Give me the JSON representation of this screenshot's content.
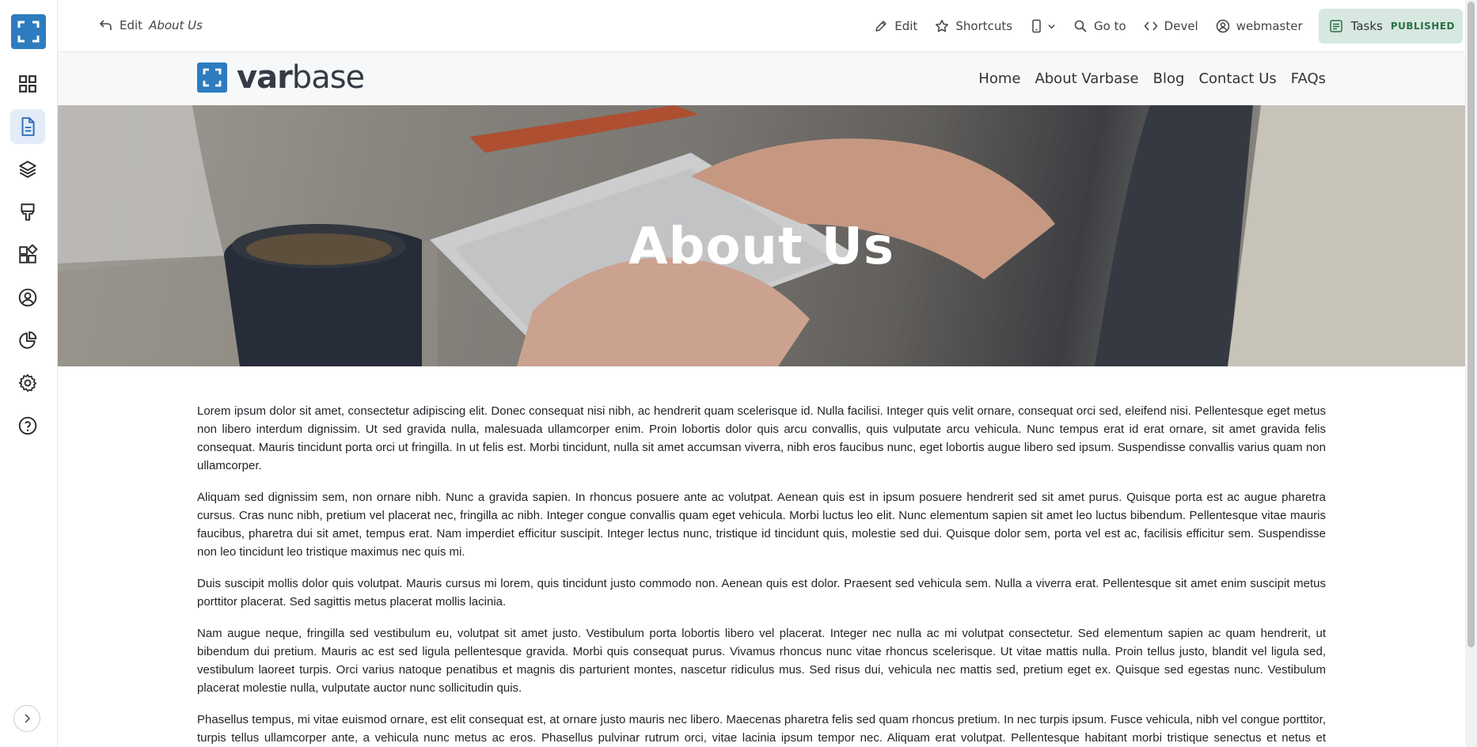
{
  "toolbar": {
    "back_prefix": "Edit",
    "back_title": "About Us",
    "items": {
      "edit": "Edit",
      "shortcuts": "Shortcuts",
      "goto": "Go to",
      "devel": "Devel",
      "user": "webmaster",
      "tasks": "Tasks",
      "status": "PUBLISHED"
    }
  },
  "brand": {
    "bold": "var",
    "rest": "base"
  },
  "nav": [
    "Home",
    "About Varbase",
    "Blog",
    "Contact Us",
    "FAQs"
  ],
  "hero": {
    "title": "About Us"
  },
  "content": {
    "paragraphs": [
      "Lorem ipsum dolor sit amet, consectetur adipiscing elit. Donec consequat nisi nibh, ac hendrerit quam scelerisque id. Nulla facilisi. Integer quis velit ornare, consequat orci sed, eleifend nisi. Pellentesque eget metus non libero interdum dignissim. Ut sed gravida nulla, malesuada ullamcorper enim. Proin lobortis dolor quis arcu convallis, quis vulputate arcu vehicula. Nunc tempus erat id erat ornare, sit amet gravida felis consequat. Mauris tincidunt porta orci ut fringilla. In ut felis est. Morbi tincidunt, nulla sit amet accumsan viverra, nibh eros faucibus nunc, eget lobortis augue libero sed ipsum. Suspendisse convallis varius quam non ullamcorper.",
      "Aliquam sed dignissim sem, non ornare nibh. Nunc a gravida sapien. In rhoncus posuere ante ac volutpat. Aenean quis est in ipsum posuere hendrerit sed sit amet purus. Quisque porta est ac augue pharetra cursus. Cras nunc nibh, pretium vel placerat nec, fringilla ac nibh. Integer congue convallis quam eget vehicula. Morbi luctus leo elit. Nunc elementum sapien sit amet leo luctus bibendum. Pellentesque vitae mauris faucibus, pharetra dui sit amet, tempus erat. Nam imperdiet efficitur suscipit. Integer lectus nunc, tristique id tincidunt quis, molestie sed dui. Quisque dolor sem, porta vel est ac, facilisis efficitur sem. Suspendisse non leo tincidunt leo tristique maximus nec quis mi.",
      "Duis suscipit mollis dolor quis volutpat. Mauris cursus mi lorem, quis tincidunt justo commodo non. Aenean quis est dolor. Praesent sed vehicula sem. Nulla a viverra erat. Pellentesque sit amet enim suscipit metus porttitor placerat. Sed sagittis metus placerat mollis lacinia.",
      "Nam augue neque, fringilla sed vestibulum eu, volutpat sit amet justo. Vestibulum porta lobortis libero vel placerat. Integer nec nulla ac mi volutpat consectetur. Sed elementum sapien ac quam hendrerit, ut bibendum dui pretium. Mauris ac est sed ligula pellentesque gravida. Morbi quis consequat purus. Vivamus rhoncus nunc vitae rhoncus scelerisque. Ut vitae mattis nulla. Proin tellus justo, blandit vel ligula sed, vestibulum laoreet turpis. Orci varius natoque penatibus et magnis dis parturient montes, nascetur ridiculus mus. Sed risus dui, vehicula nec mattis sed, pretium eget ex. Quisque sed egestas nunc. Vestibulum placerat molestie nulla, vulputate auctor nunc sollicitudin quis.",
      "Phasellus tempus, mi vitae euismod ornare, est elit consequat est, at ornare justo mauris nec libero. Maecenas pharetra felis sed quam rhoncus pretium. In nec turpis ipsum. Fusce vehicula, nibh vel congue porttitor, turpis tellus ullamcorper ante, a vehicula nunc metus ac eros. Phasellus pulvinar rutrum orci, vitae lacinia ipsum tempor nec. Aliquam erat volutpat. Pellentesque habitant morbi tristique senectus et netus et malesuada fames ac turpis egestas."
    ]
  },
  "colors": {
    "brand_blue": "#2d7cc0",
    "tasks_bg": "#d7e8e0",
    "sidebar_active": "#e3ecf8"
  }
}
